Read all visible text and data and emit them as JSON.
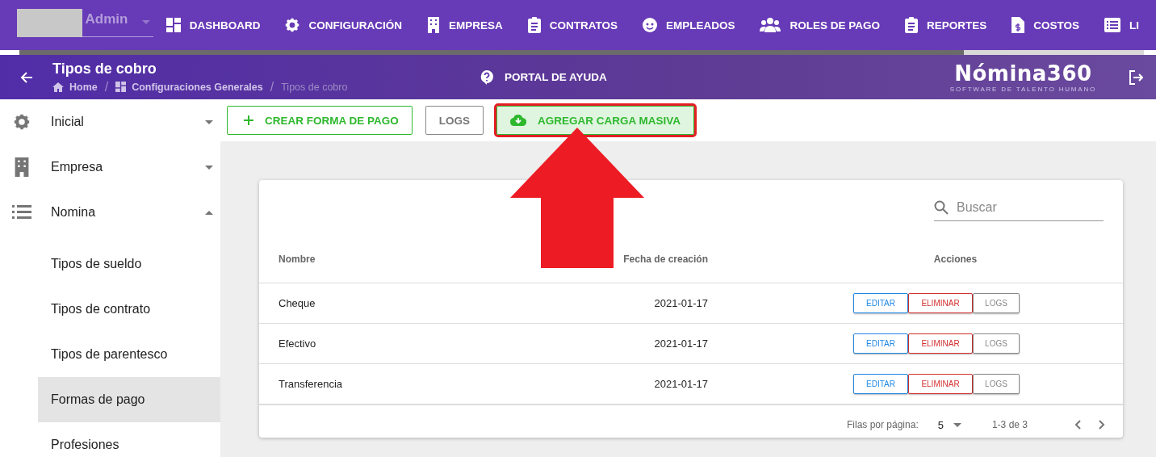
{
  "top_nav": {
    "user_select": {
      "value": "Admin"
    },
    "items": [
      {
        "label": "DASHBOARD"
      },
      {
        "label": "CONFIGURACIÓN"
      },
      {
        "label": "EMPRESA"
      },
      {
        "label": "CONTRATOS"
      },
      {
        "label": "EMPLEADOS"
      },
      {
        "label": "ROLES DE PAGO"
      },
      {
        "label": "REPORTES"
      },
      {
        "label": "COSTOS"
      },
      {
        "label": "LI"
      }
    ]
  },
  "progress": {
    "level": 0.84
  },
  "header": {
    "title": "Tipos de cobro",
    "breadcrumbs": [
      {
        "label": "Home",
        "current": false
      },
      {
        "separator": "/",
        "label": "Configuraciones Generales",
        "current": false
      },
      {
        "separator": "/",
        "label": "Tipos de cobro",
        "current": true
      }
    ],
    "help_link": "PORTAL DE AYUDA",
    "logo": {
      "name": "Nómina360",
      "tagline": "SOFTWARE DE TALENTO HUMANO"
    }
  },
  "sidebar": {
    "items": [
      {
        "label": "Inicial",
        "expanded": false
      },
      {
        "label": "Empresa",
        "expanded": false
      },
      {
        "label": "Nomina",
        "expanded": true,
        "children": [
          {
            "label": "Tipos de sueldo",
            "selected": false
          },
          {
            "label": "Tipos de contrato",
            "selected": false
          },
          {
            "label": "Tipos de parentesco",
            "selected": false
          },
          {
            "label": "Formas de pago",
            "selected": true
          },
          {
            "label": "Profesiones",
            "selected": false
          }
        ]
      }
    ]
  },
  "toolbar": {
    "buttons": [
      {
        "label": "CREAR FORMA DE PAGO",
        "kind": "create",
        "highlighted": false
      },
      {
        "label": "LOGS",
        "kind": "plain",
        "highlighted": false
      },
      {
        "label": "AGREGAR CARGA MASIVA",
        "kind": "upload",
        "highlighted": true
      }
    ]
  },
  "table": {
    "search": {
      "placeholder": "Buscar"
    },
    "columns": [
      "Nombre",
      "Fecha de creación",
      "Acciones"
    ],
    "rows": [
      {
        "name": "Cheque",
        "date": "2021-01-17",
        "actions": [
          "EDITAR",
          "ELIMINAR",
          "LOGS"
        ]
      },
      {
        "name": "Efectivo",
        "date": "2021-01-17",
        "actions": [
          "EDITAR",
          "ELIMINAR",
          "LOGS"
        ]
      },
      {
        "name": "Transferencia",
        "date": "2021-01-17",
        "actions": [
          "EDITAR",
          "ELIMINAR",
          "LOGS"
        ]
      }
    ],
    "footer": {
      "rows_per_page_label": "Filas por página:",
      "rows_per_page": "5",
      "range": "1-3 de 3"
    }
  }
}
